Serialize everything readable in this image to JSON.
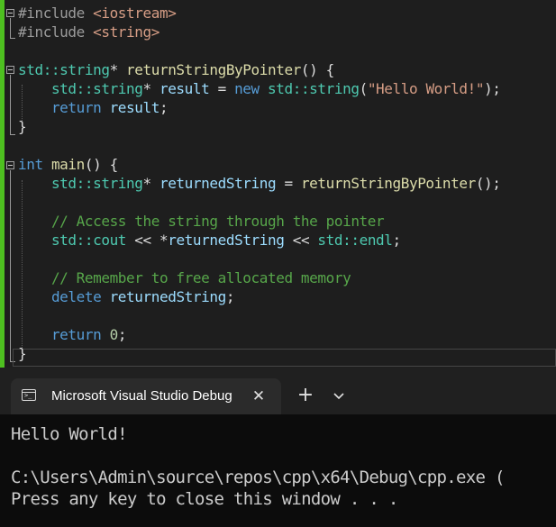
{
  "editor": {
    "lines": [
      [
        {
          "c": "pp",
          "t": "#include "
        },
        {
          "c": "st",
          "t": "<iostream>"
        }
      ],
      [
        {
          "c": "pp",
          "t": "#include "
        },
        {
          "c": "st",
          "t": "<string>"
        }
      ],
      [],
      [
        {
          "c": "ty",
          "t": "std::string"
        },
        {
          "c": "pl",
          "t": "* "
        },
        {
          "c": "fn",
          "t": "returnStringByPointer"
        },
        {
          "c": "pl",
          "t": "() {"
        }
      ],
      [
        {
          "c": "pl",
          "t": "    "
        },
        {
          "c": "ty",
          "t": "std::string"
        },
        {
          "c": "pl",
          "t": "* "
        },
        {
          "c": "id",
          "t": "result"
        },
        {
          "c": "pl",
          "t": " = "
        },
        {
          "c": "kw",
          "t": "new"
        },
        {
          "c": "pl",
          "t": " "
        },
        {
          "c": "ty",
          "t": "std::string"
        },
        {
          "c": "pl",
          "t": "("
        },
        {
          "c": "st",
          "t": "\"Hello World!\""
        },
        {
          "c": "pl",
          "t": ");"
        }
      ],
      [
        {
          "c": "pl",
          "t": "    "
        },
        {
          "c": "kw",
          "t": "return"
        },
        {
          "c": "pl",
          "t": " "
        },
        {
          "c": "id",
          "t": "result"
        },
        {
          "c": "pl",
          "t": ";"
        }
      ],
      [
        {
          "c": "pl",
          "t": "}"
        }
      ],
      [],
      [
        {
          "c": "kw",
          "t": "int"
        },
        {
          "c": "pl",
          "t": " "
        },
        {
          "c": "fn",
          "t": "main"
        },
        {
          "c": "pl",
          "t": "() {"
        }
      ],
      [
        {
          "c": "pl",
          "t": "    "
        },
        {
          "c": "ty",
          "t": "std::string"
        },
        {
          "c": "pl",
          "t": "* "
        },
        {
          "c": "id",
          "t": "returnedString"
        },
        {
          "c": "pl",
          "t": " = "
        },
        {
          "c": "fn",
          "t": "returnStringByPointer"
        },
        {
          "c": "pl",
          "t": "();"
        }
      ],
      [],
      [
        {
          "c": "pl",
          "t": "    "
        },
        {
          "c": "cm",
          "t": "// Access the string through the pointer"
        }
      ],
      [
        {
          "c": "pl",
          "t": "    "
        },
        {
          "c": "ty",
          "t": "std::cout"
        },
        {
          "c": "pl",
          "t": " << *"
        },
        {
          "c": "id",
          "t": "returnedString"
        },
        {
          "c": "pl",
          "t": " << "
        },
        {
          "c": "ty",
          "t": "std::endl"
        },
        {
          "c": "pl",
          "t": ";"
        }
      ],
      [],
      [
        {
          "c": "pl",
          "t": "    "
        },
        {
          "c": "cm",
          "t": "// Remember to free allocated memory"
        }
      ],
      [
        {
          "c": "pl",
          "t": "    "
        },
        {
          "c": "kw",
          "t": "delete"
        },
        {
          "c": "pl",
          "t": " "
        },
        {
          "c": "id",
          "t": "returnedString"
        },
        {
          "c": "pl",
          "t": ";"
        }
      ],
      [],
      [
        {
          "c": "pl",
          "t": "    "
        },
        {
          "c": "kw",
          "t": "return"
        },
        {
          "c": "pl",
          "t": " "
        },
        {
          "c": "nm",
          "t": "0"
        },
        {
          "c": "pl",
          "t": ";"
        }
      ],
      [
        {
          "c": "pl",
          "t": "}"
        }
      ]
    ],
    "colors": {
      "background": "#1e1e1e",
      "change_bar": "#4ec020",
      "keyword": "#569cd6",
      "type": "#4ec9b0",
      "function": "#dcdcaa",
      "identifier": "#9cdcfe",
      "string": "#d69d85",
      "comment": "#57a64a",
      "preprocessor": "#9b9b9b"
    }
  },
  "terminal": {
    "tab_title": "Microsoft Visual Studio Debug Console",
    "tab_icon": "terminal-icon",
    "close_icon": "close-icon",
    "new_tab_icon": "plus-icon",
    "dropdown_icon": "chevron-down-icon",
    "tab_icon_glyph": ">_",
    "close_glyph": "✕",
    "new_tab_glyph": "+",
    "lines": [
      "Hello World!",
      "",
      "C:\\Users\\Admin\\source\\repos\\cpp\\x64\\Debug\\cpp.exe (",
      "Press any key to close this window . . ."
    ],
    "colors": {
      "background": "#0c0c0c",
      "tab_strip": "#202020",
      "active_tab": "#2b2b2b",
      "text": "#cccccc"
    }
  }
}
